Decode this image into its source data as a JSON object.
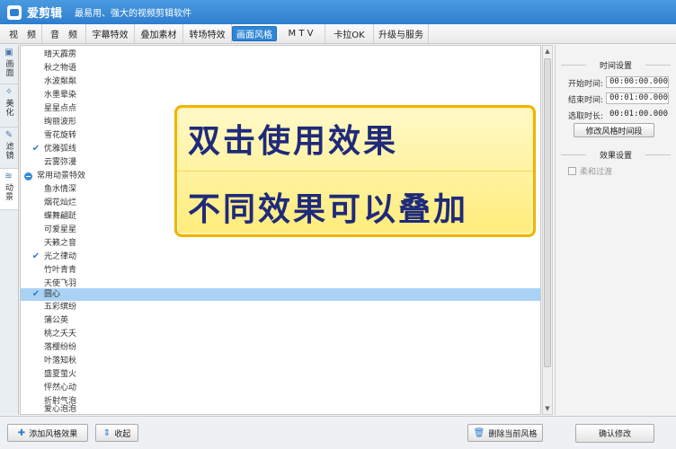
{
  "titlebar": {
    "app_name": "爱剪辑",
    "slogan": "最易用、强大的视频剪辑软件"
  },
  "menu": {
    "tabs": [
      {
        "label": "视　频"
      },
      {
        "label": "音　频"
      },
      {
        "label": "字幕特效"
      },
      {
        "label": "叠加素材"
      },
      {
        "label": "转场特效"
      },
      {
        "label": "画面风格"
      },
      {
        "label": "M T V"
      },
      {
        "label": "卡拉OK"
      },
      {
        "label": "升级与服务"
      }
    ],
    "active_index": 5
  },
  "sidetabs": [
    {
      "label": "画面",
      "icon": "picture-icon"
    },
    {
      "label": "美化",
      "icon": "magic-wand-icon"
    },
    {
      "label": "滤镜",
      "icon": "brush-icon"
    },
    {
      "label": "动景",
      "icon": "wave-icon"
    }
  ],
  "effects": [
    {
      "label": "晴天霹雳",
      "checked": false
    },
    {
      "label": "秋之物语",
      "checked": false
    },
    {
      "label": "水波粼粼",
      "checked": false
    },
    {
      "label": "水墨晕染",
      "checked": false
    },
    {
      "label": "星星点点",
      "checked": false
    },
    {
      "label": "绚丽波形",
      "checked": false
    },
    {
      "label": "雪花旋转",
      "checked": false
    },
    {
      "label": "优雅弧线",
      "checked": true
    },
    {
      "label": "云雾弥漫",
      "checked": false
    },
    {
      "label": "常用动景特效",
      "category": true
    },
    {
      "label": "鱼水情深",
      "checked": false
    },
    {
      "label": "烟花灿烂",
      "checked": false
    },
    {
      "label": "蝶舞翩跹",
      "checked": false
    },
    {
      "label": "可爱星星",
      "checked": false
    },
    {
      "label": "天籁之音",
      "checked": false
    },
    {
      "label": "光之律动",
      "checked": true
    },
    {
      "label": "竹叶青青",
      "checked": false
    },
    {
      "label": "天使飞羽",
      "checked": false
    },
    {
      "label": "圆心",
      "checked": true,
      "selected": true
    },
    {
      "label": "五彩缤纷",
      "checked": false
    },
    {
      "label": "蒲公英",
      "checked": false
    },
    {
      "label": "桃之夭夭",
      "checked": false
    },
    {
      "label": "落樱纷纷",
      "checked": false
    },
    {
      "label": "叶落知秋",
      "checked": false
    },
    {
      "label": "盛夏萤火",
      "checked": false
    },
    {
      "label": "怦然心动",
      "checked": false
    },
    {
      "label": "折射气泡",
      "checked": false
    },
    {
      "label": "爱心泡泡",
      "checked": false
    }
  ],
  "overlay": {
    "line1": "双击使用效果",
    "line2": "不同效果可以叠加"
  },
  "settings": {
    "time_section": "时间设置",
    "start_label": "开始时间:",
    "start_value": "00:00:00.000",
    "end_label": "结束时间:",
    "end_value": "00:01:00.000",
    "duration_label": "选取时长:",
    "duration_value": "00:01:00.000",
    "modify_segment_btn": "修改风格时间段",
    "effect_section": "效果设置",
    "smooth_label": "柔和过渡",
    "confirm_btn": "确认修改"
  },
  "bottom": {
    "add_btn": "添加风格效果",
    "collapse_btn": "收起",
    "delete_btn": "删除当前风格"
  },
  "colors": {
    "accent": "#2e7fcf",
    "selected_row": "#a9d2f5",
    "overlay_border": "#f0b400",
    "overlay_text": "#1f2a7a"
  }
}
